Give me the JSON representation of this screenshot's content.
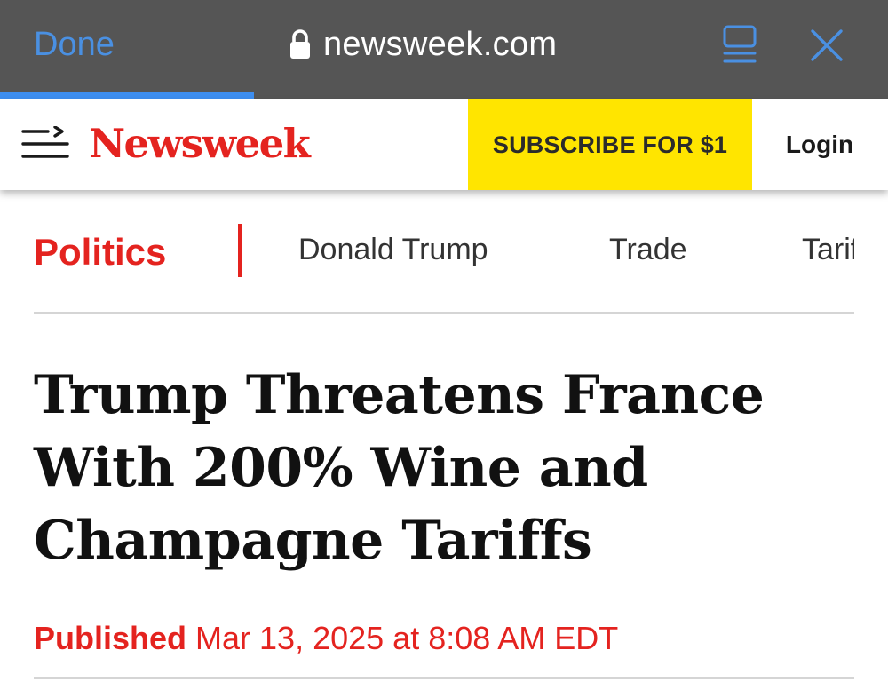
{
  "browser": {
    "done_label": "Done",
    "url": "newsweek.com",
    "load_progress": 0.286,
    "accent_color": "#4a90e2"
  },
  "header": {
    "logo_text": "Newsweek",
    "subscribe_label": "SUBSCRIBE FOR $1",
    "login_label": "Login",
    "brand_color": "#e4231f",
    "subscribe_bg": "#ffe500"
  },
  "nav": {
    "section": "Politics",
    "topics": [
      "Donald Trump",
      "Trade",
      "Tariffs"
    ]
  },
  "article": {
    "headline_lines": [
      "Trump Threatens France",
      "With 200% Wine and",
      "Champagne Tariffs"
    ],
    "published_label": "Published",
    "published_date": "Mar 13, 2025 at 8:08 AM EDT"
  },
  "icons": [
    "lock-icon",
    "reader-view-icon",
    "close-icon",
    "menu-icon"
  ]
}
